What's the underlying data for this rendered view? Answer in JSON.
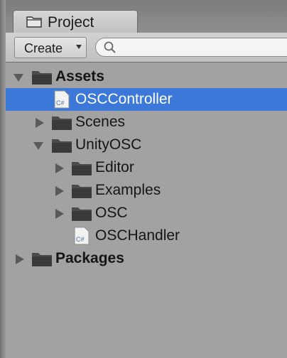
{
  "window": {
    "tab_title": "Project"
  },
  "toolbar": {
    "create_label": "Create",
    "search_placeholder": ""
  },
  "tree": {
    "items": [
      {
        "label": "Assets",
        "type": "folder",
        "expanded": true,
        "bold": true
      },
      {
        "label": "OSCController",
        "type": "cs-file",
        "selected": true,
        "icon_text": "C#"
      },
      {
        "label": "Scenes",
        "type": "folder",
        "expanded": false
      },
      {
        "label": "UnityOSC",
        "type": "folder",
        "expanded": true
      },
      {
        "label": "Editor",
        "type": "folder",
        "expanded": false
      },
      {
        "label": "Examples",
        "type": "folder",
        "expanded": false
      },
      {
        "label": "OSC",
        "type": "folder",
        "expanded": false
      },
      {
        "label": "OSCHandler",
        "type": "cs-file",
        "icon_text": "C#"
      },
      {
        "label": "Packages",
        "type": "folder",
        "expanded": false,
        "bold": true
      }
    ]
  },
  "colors": {
    "selection": "#3c78d8",
    "panel_bg": "#a2a2a2"
  }
}
